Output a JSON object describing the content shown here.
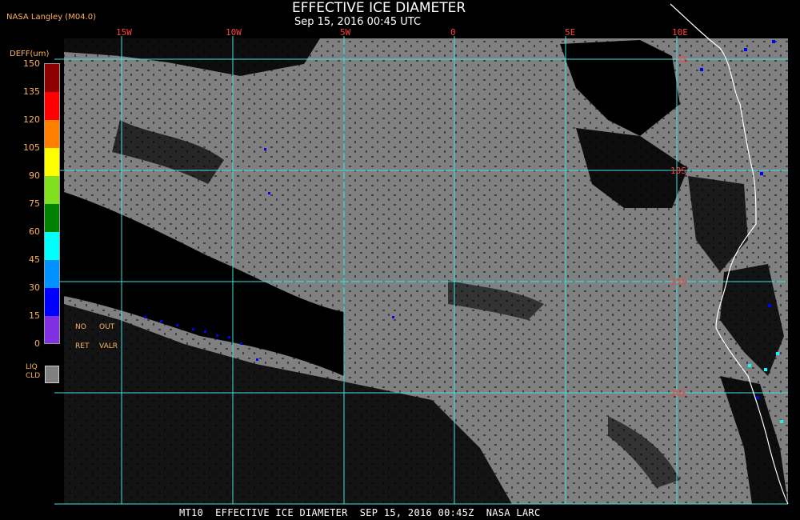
{
  "header": {
    "title": "EFFECTIVE ICE DIAMETER",
    "subtitle": "Sep 15, 2016 00:45 UTC",
    "producer": "NASA Langley (M04.0)"
  },
  "footer": {
    "caption": "MT10  EFFECTIVE ICE DIAMETER  SEP 15, 2016 00:45Z  NASA LARC"
  },
  "legend": {
    "unit_label": "DEFF(um)",
    "ticks": [
      "150",
      "135",
      "120",
      "105",
      "90",
      "75",
      "60",
      "45",
      "30",
      "15",
      "0"
    ],
    "bins": [
      {
        "min": 135,
        "max": 150,
        "color": "#8b0000"
      },
      {
        "min": 120,
        "max": 135,
        "color": "#ff0000"
      },
      {
        "min": 105,
        "max": 120,
        "color": "#ff8000"
      },
      {
        "min": 90,
        "max": 105,
        "color": "#ffff00"
      },
      {
        "min": 75,
        "max": 90,
        "color": "#80e020"
      },
      {
        "min": 60,
        "max": 75,
        "color": "#008000"
      },
      {
        "min": 45,
        "max": 60,
        "color": "#00ffff"
      },
      {
        "min": 30,
        "max": 45,
        "color": "#0090ff"
      },
      {
        "min": 15,
        "max": 30,
        "color": "#0000ff"
      },
      {
        "min": 0,
        "max": 15,
        "color": "#8030e0"
      }
    ],
    "no_ret_line1": "NO",
    "no_ret_line2": "RET",
    "out_valr_line1": "OUT",
    "out_valr_line2": "VALR",
    "liq_line1": "LIQ",
    "liq_line2": "CLD",
    "liq_color": "#808080"
  },
  "map": {
    "cloud_color": "#808080",
    "clear_color": "#000000",
    "grid_color": "#40e0e0",
    "coast_color": "#ffffff",
    "lon_labels": [
      "15W",
      "10W",
      "5W",
      "0",
      "5E",
      "10E"
    ],
    "lat_labels": [
      "5S",
      "10S",
      "15S",
      "20S"
    ]
  }
}
